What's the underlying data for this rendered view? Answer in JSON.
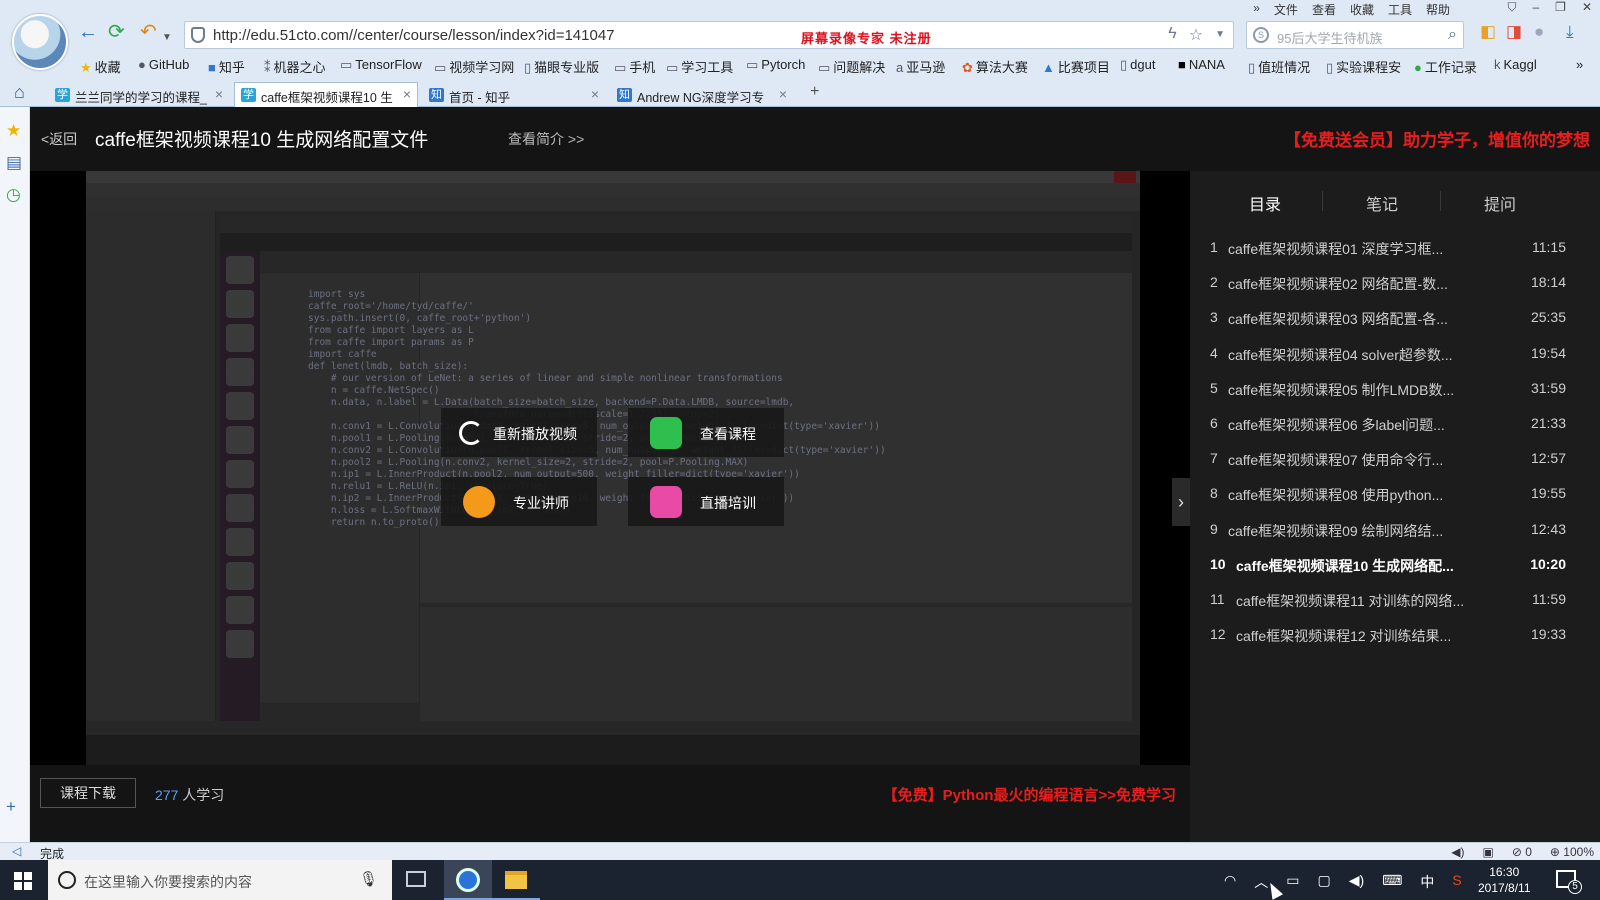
{
  "browser": {
    "menu": [
      "»",
      "文件",
      "查看",
      "收藏",
      "工具",
      "帮助"
    ],
    "url": "http://edu.51cto.com//center/course/lesson/index?id=141047",
    "recorder_watermark": "屏幕录像专家  未注册",
    "search_placeholder": "95后大学生待机族",
    "bookmarks": [
      "收藏",
      "GitHub",
      "知乎",
      "机器之心",
      "TensorFlow",
      "视频学习网",
      "猫眼专业版",
      "手机",
      "学习工具",
      "Pytorch",
      "问题解决",
      "亚马逊",
      "算法大赛",
      "比赛项目",
      "dgut",
      "NANA",
      "值班情况",
      "实验课程安",
      "工作记录",
      "Kaggl"
    ],
    "tabs": [
      {
        "title": "兰兰同学的学习的课程_",
        "fav": "学"
      },
      {
        "title": "caffe框架视频课程10 生",
        "fav": "学"
      },
      {
        "title": "首页 - 知乎",
        "fav": "知"
      },
      {
        "title": "Andrew NG深度学习专",
        "fav": "知"
      }
    ],
    "tab_plus": "+"
  },
  "course": {
    "back_label": "<返回",
    "title": "caffe框架视频课程10 生成网络配置文件",
    "intro_link": "查看简介 >>",
    "promo": "【免费送会员】助力学子，增值你的梦想"
  },
  "overlay": {
    "replay": "重新播放视频",
    "view_course": "查看课程",
    "lecturer": "专业讲师",
    "live": "直播培训"
  },
  "video_code": [
    "import sys",
    "caffe_root='/home/tyd/caffe/'",
    "sys.path.insert(0, caffe_root+'python')",
    "from caffe import layers as L",
    "from caffe import params as P",
    "import caffe",
    "",
    "def lenet(lmdb, batch_size):",
    "    # our version of LeNet: a series of linear and simple nonlinear transformations",
    "    n = caffe.NetSpec()",
    "    n.data, n.label = L.Data(batch_size=batch_size, backend=P.Data.LMDB, source=lmdb,",
    "                             transform_param=dict(scale=1./255), ntop=2)",
    "    n.conv1 = L.Convolution(n.data, kernel_size=5, num_output=20, weight_filler=dict(type='xavier'))",
    "    n.pool1 = L.Pooling(n.conv1, kernel_size=2, stride=2, pool=P.Pooling.MAX)",
    "    n.conv2 = L.Convolution(n.pool1, kernel_size=5, num_output=50, weight_filler=dict(type='xavier'))",
    "    n.pool2 = L.Pooling(n.conv2, kernel_size=2, stride=2, pool=P.Pooling.MAX)",
    "    n.ip1 = L.InnerProduct(n.pool2, num_output=500, weight_filler=dict(type='xavier'))",
    "    n.relu1 = L.ReLU(n.ip1, in_place=True)",
    "    n.ip2 = L.InnerProduct(n.relu1, num_output=10, weight_filler=dict(type='xavier'))",
    "    n.loss = L.SoftmaxWithLoss(n.ip2, n.label)",
    "    return n.to_proto()"
  ],
  "catalog": {
    "tabs": [
      "目录",
      "笔记",
      "提问"
    ],
    "lessons": [
      {
        "num": "1",
        "name": "caffe框架视频课程01 深度学习框...",
        "dur": "11:15"
      },
      {
        "num": "2",
        "name": "caffe框架视频课程02 网络配置-数...",
        "dur": "18:14"
      },
      {
        "num": "3",
        "name": "caffe框架视频课程03 网络配置-各...",
        "dur": "25:35"
      },
      {
        "num": "4",
        "name": "caffe框架视频课程04 solver超参数...",
        "dur": "19:54"
      },
      {
        "num": "5",
        "name": "caffe框架视频课程05 制作LMDB数...",
        "dur": "31:59"
      },
      {
        "num": "6",
        "name": "caffe框架视频课程06 多label问题...",
        "dur": "21:33"
      },
      {
        "num": "7",
        "name": "caffe框架视频课程07 使用命令行...",
        "dur": "12:57"
      },
      {
        "num": "8",
        "name": "caffe框架视频课程08 使用python...",
        "dur": "19:55"
      },
      {
        "num": "9",
        "name": "caffe框架视频课程09 绘制网络结...",
        "dur": "12:43"
      },
      {
        "num": "10",
        "name": "caffe框架视频课程10 生成网络配...",
        "dur": "10:20"
      },
      {
        "num": "11",
        "name": "caffe框架视频课程11 对训练的网络...",
        "dur": "11:59"
      },
      {
        "num": "12",
        "name": "caffe框架视频课程12 对训练结果...",
        "dur": "19:33"
      }
    ]
  },
  "bottom": {
    "download": "课程下载",
    "learners_count": "277",
    "learners_suffix": " 人学习",
    "ad": "【免费】Python最火的编程语言>>免费学习"
  },
  "statusbar": {
    "left": "完成",
    "zero_count": "0",
    "zoom": "100%"
  },
  "taskbar": {
    "search_placeholder": "在这里输入你要搜索的内容",
    "ime": "中",
    "time": "16:30",
    "date": "2017/8/11",
    "notifications": "5"
  }
}
